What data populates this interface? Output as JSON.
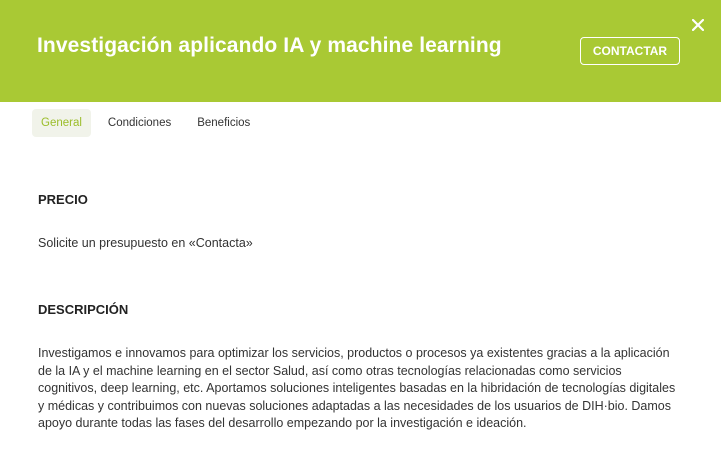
{
  "header": {
    "title": "Investigación aplicando IA y machine learning",
    "contact_label": "CONTACTAR"
  },
  "tabs": [
    {
      "label": "General",
      "active": true
    },
    {
      "label": "Condiciones",
      "active": false
    },
    {
      "label": "Beneficios",
      "active": false
    }
  ],
  "sections": {
    "precio": {
      "title": "PRECIO",
      "text": "Solicite un presupuesto en «Contacta»"
    },
    "descripcion": {
      "title": "DESCRIPCIÓN",
      "text": "Investigamos e innovamos para optimizar los servicios, productos o procesos ya existentes gracias a la aplicación de la IA y el machine learning en el sector Salud, así como otras tecnologías relacionadas como servicios cognitivos, deep learning, etc. Aportamos soluciones inteligentes basadas en la hibridación de tecnologías digitales y médicas y contribuimos con nuevas soluciones adaptadas a las necesidades de los usuarios de DIH·bio. Damos apoyo durante todas las fases del desarrollo empezando por la investigación e ideación."
    }
  },
  "colors": {
    "brand": "#a9c934",
    "tab_active_text": "#9bbd2a",
    "tab_active_bg": "#f1f3ea"
  },
  "icons": {
    "close": "close-icon"
  }
}
